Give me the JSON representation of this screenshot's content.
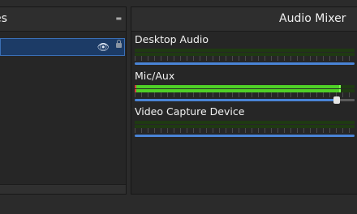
{
  "sources": {
    "title": "es",
    "float_icon": "float-icon",
    "selected_item": {
      "visible_icon": "eye-icon",
      "lock_icon": "lock-icon"
    }
  },
  "mixer": {
    "title": "Audio Mixer",
    "channels": [
      {
        "name": "Desktop Audio",
        "level": 0.0,
        "volume": 1.0
      },
      {
        "name": "Mic/Aux",
        "level": 0.93,
        "peak": 0.93,
        "volume": 0.92
      },
      {
        "name": "Video Capture Device",
        "level": 0.0,
        "volume": 1.0
      }
    ]
  },
  "colors": {
    "meter_green": "#4fd127",
    "meter_bg": "#1f3a12",
    "slider_blue": "#4a84d6",
    "selection_blue": "#1c3b66"
  }
}
